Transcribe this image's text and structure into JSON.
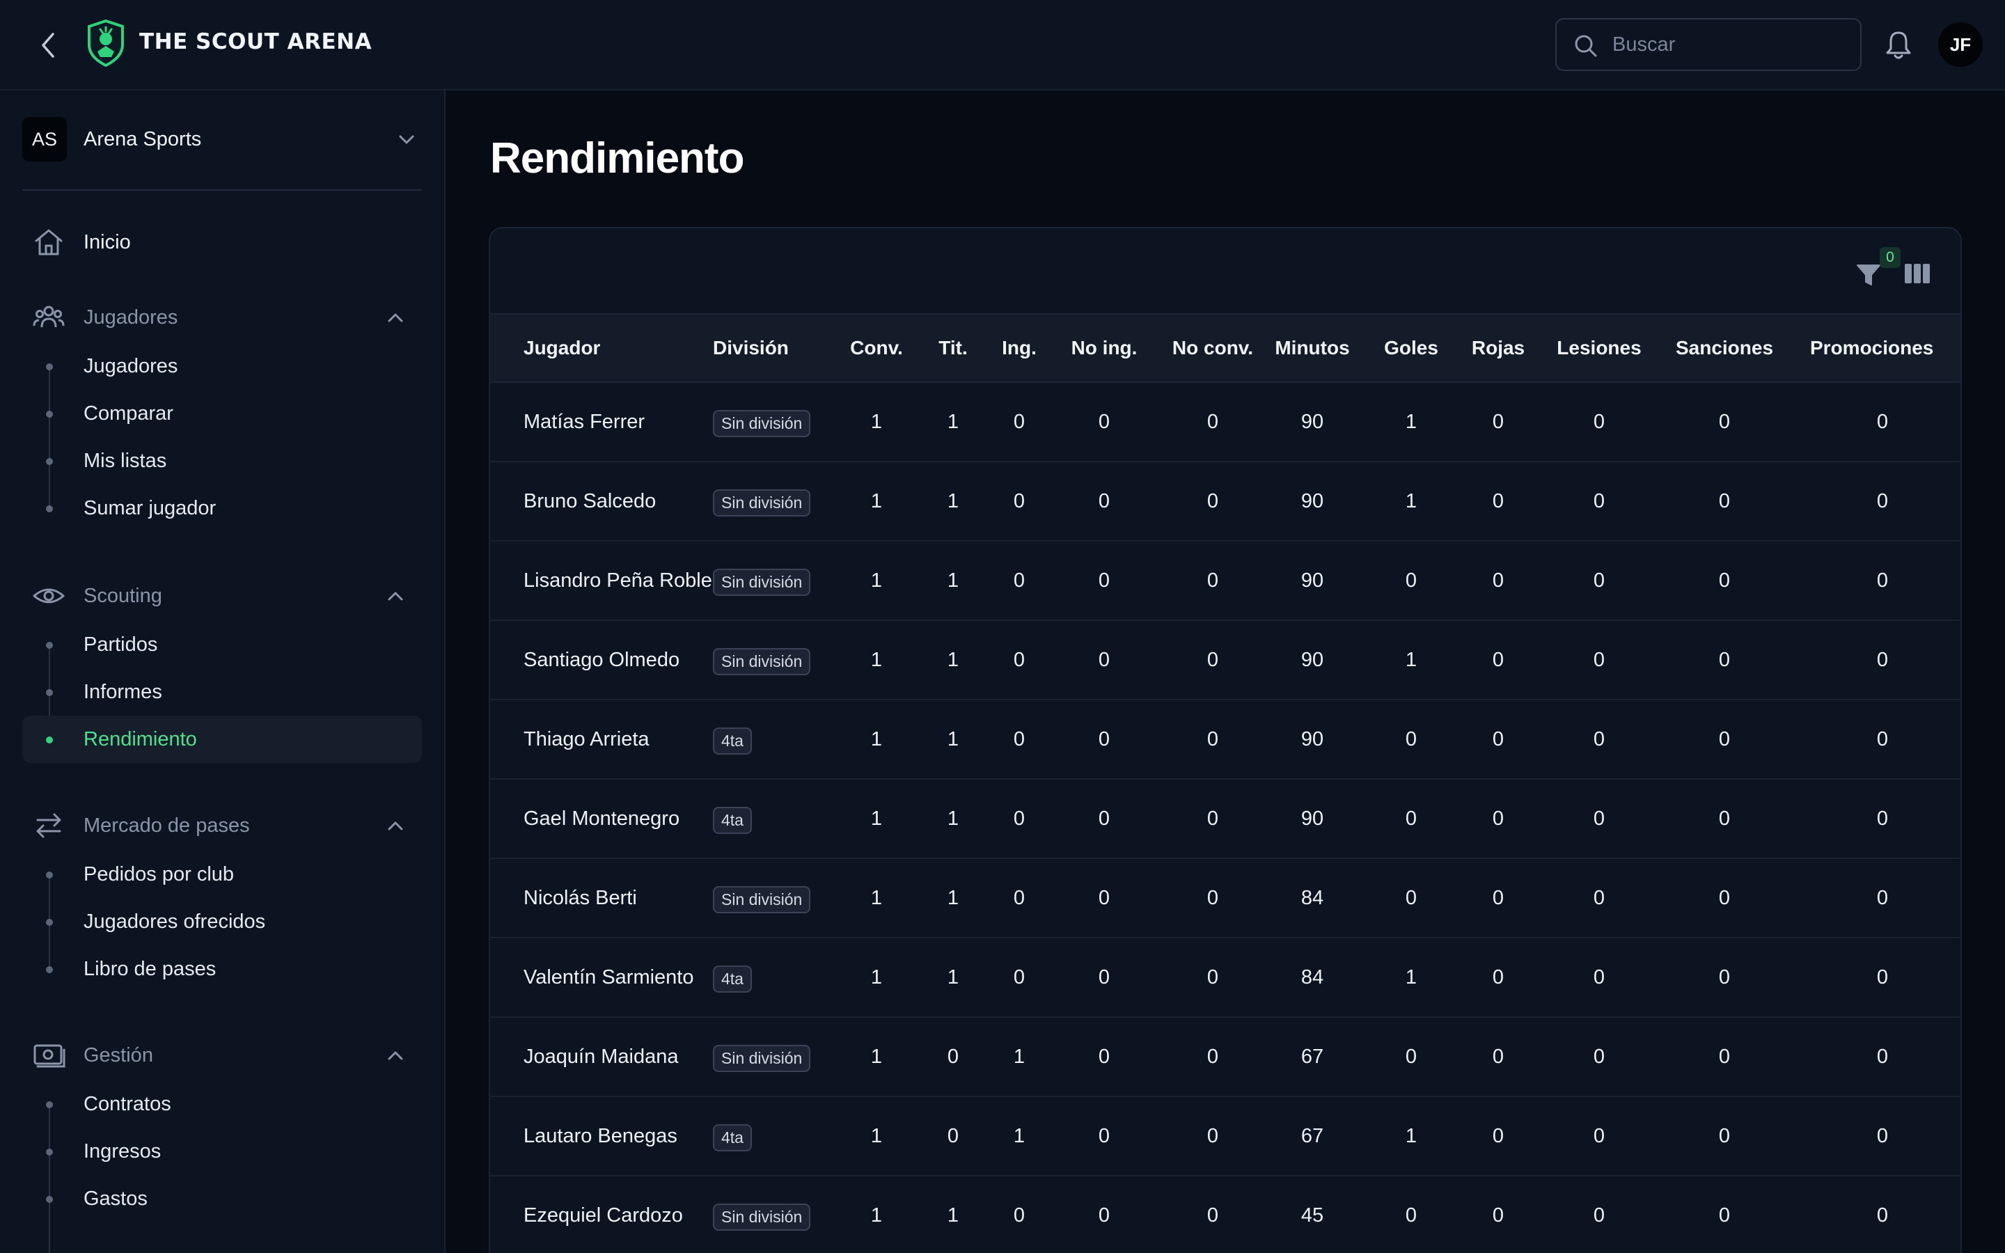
{
  "header": {
    "brand": "THE SCOUT ARENA",
    "search_placeholder": "Buscar",
    "avatar_initials": "JF"
  },
  "sidebar": {
    "org": {
      "initials": "AS",
      "name": "Arena Sports"
    },
    "home": "Inicio",
    "groups": [
      {
        "label": "Jugadores",
        "items": [
          "Jugadores",
          "Comparar",
          "Mis listas",
          "Sumar jugador"
        ]
      },
      {
        "label": "Scouting",
        "items": [
          "Partidos",
          "Informes",
          "Rendimiento"
        ]
      },
      {
        "label": "Mercado de pases",
        "items": [
          "Pedidos por club",
          "Jugadores ofrecidos",
          "Libro de pases"
        ]
      },
      {
        "label": "Gestión",
        "items": [
          "Contratos",
          "Ingresos",
          "Gastos"
        ]
      }
    ],
    "active_item": "Rendimiento"
  },
  "main": {
    "title": "Rendimiento",
    "filter_count": "0",
    "columns": [
      "Jugador",
      "División",
      "Conv.",
      "Tit.",
      "Ing.",
      "No ing.",
      "No conv.",
      "Minutos",
      "Goles",
      "Rojas",
      "Lesiones",
      "Sanciones",
      "Promociones"
    ],
    "rows": [
      [
        "Matías Ferrer",
        "Sin división",
        "1",
        "1",
        "0",
        "0",
        "0",
        "90",
        "1",
        "0",
        "0",
        "0",
        "0"
      ],
      [
        "Bruno Salcedo",
        "Sin división",
        "1",
        "1",
        "0",
        "0",
        "0",
        "90",
        "1",
        "0",
        "0",
        "0",
        "0"
      ],
      [
        "Lisandro Peña Roble",
        "Sin división",
        "1",
        "1",
        "0",
        "0",
        "0",
        "90",
        "0",
        "0",
        "0",
        "0",
        "0"
      ],
      [
        "Santiago Olmedo",
        "Sin división",
        "1",
        "1",
        "0",
        "0",
        "0",
        "90",
        "1",
        "0",
        "0",
        "0",
        "0"
      ],
      [
        "Thiago Arrieta",
        "4ta",
        "1",
        "1",
        "0",
        "0",
        "0",
        "90",
        "0",
        "0",
        "0",
        "0",
        "0"
      ],
      [
        "Gael Montenegro",
        "4ta",
        "1",
        "1",
        "0",
        "0",
        "0",
        "90",
        "0",
        "0",
        "0",
        "0",
        "0"
      ],
      [
        "Nicolás Berti",
        "Sin división",
        "1",
        "1",
        "0",
        "0",
        "0",
        "84",
        "0",
        "0",
        "0",
        "0",
        "0"
      ],
      [
        "Valentín Sarmiento",
        "4ta",
        "1",
        "1",
        "0",
        "0",
        "0",
        "84",
        "1",
        "0",
        "0",
        "0",
        "0"
      ],
      [
        "Joaquín Maidana",
        "Sin división",
        "1",
        "0",
        "1",
        "0",
        "0",
        "67",
        "0",
        "0",
        "0",
        "0",
        "0"
      ],
      [
        "Lautaro Benegas",
        "4ta",
        "1",
        "0",
        "1",
        "0",
        "0",
        "67",
        "1",
        "0",
        "0",
        "0",
        "0"
      ],
      [
        "Ezequiel Cardozo",
        "Sin división",
        "1",
        "1",
        "0",
        "0",
        "0",
        "45",
        "0",
        "0",
        "0",
        "0",
        "0"
      ]
    ]
  },
  "colors": {
    "accent": "#34d17a",
    "background": "#070b13",
    "panel": "#0c1321"
  }
}
